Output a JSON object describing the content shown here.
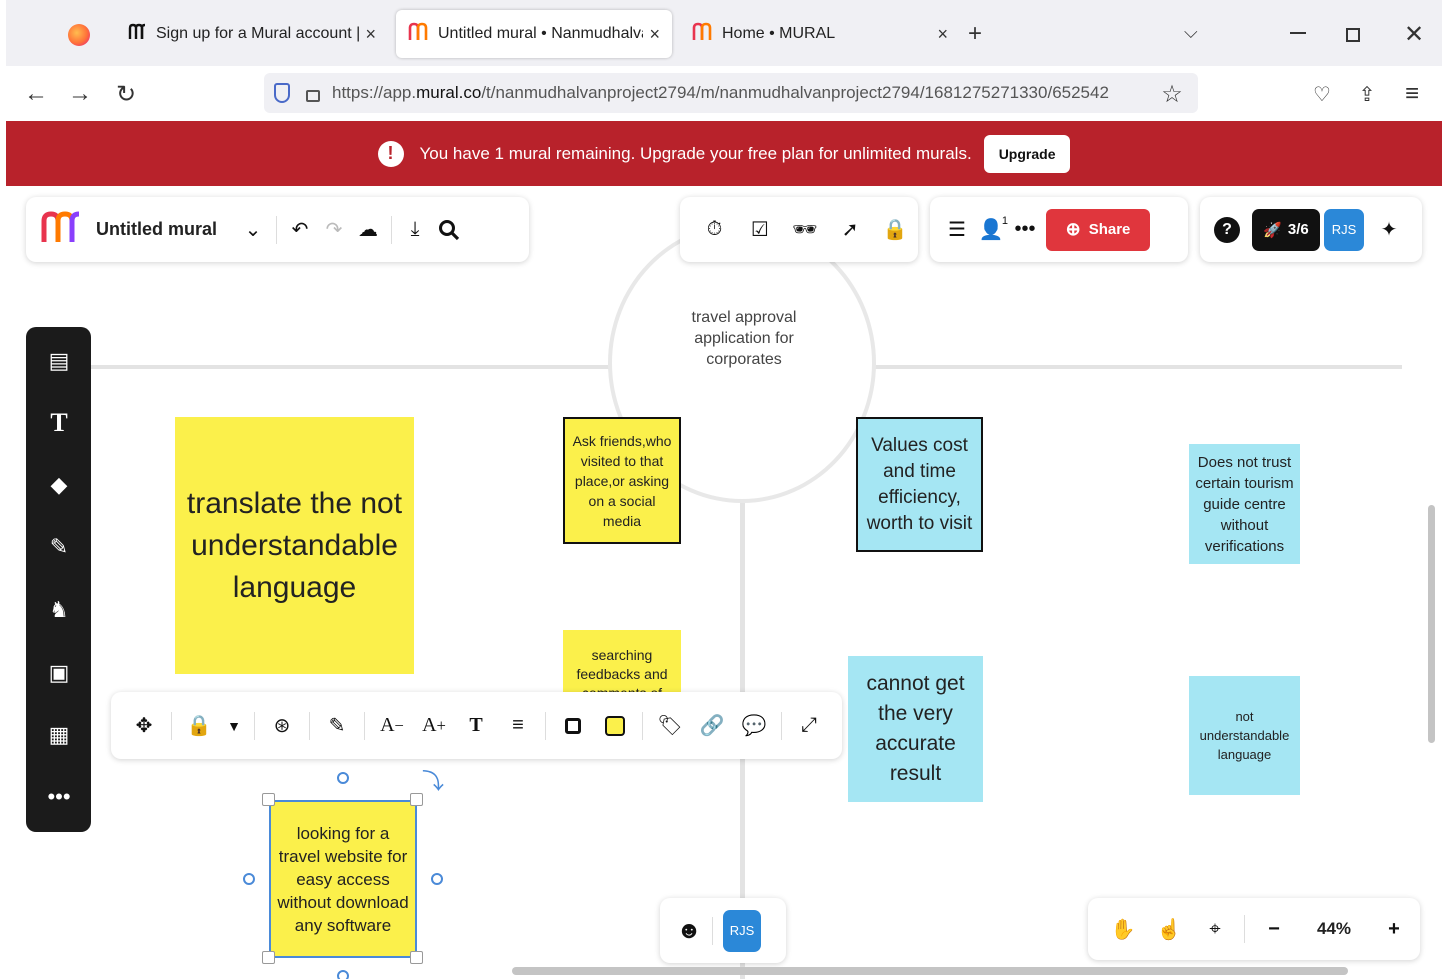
{
  "browser": {
    "tabs": [
      {
        "label": "Sign up for a Mural account | M",
        "close": "×"
      },
      {
        "label": "Untitled mural • Nanmudhalvan",
        "close": "×"
      },
      {
        "label": "Home • MURAL",
        "close": "×"
      }
    ],
    "new_tab": "+",
    "url_prefix": "https://app.",
    "url_domain": "mural.co",
    "url_rest": "/t/nanmudhalvanproject2794/m/nanmudhalvanproject2794/1681275271330/652542"
  },
  "banner": {
    "message": "You have 1 mural remaining. Upgrade your free plan for unlimited murals.",
    "upgrade_label": "Upgrade",
    "bg_color": "#b8222b"
  },
  "toolbar": {
    "mural_title": "Untitled mural",
    "share_label": "Share",
    "progress_label": "3/6",
    "avatar_initials": "RJS",
    "collab_count": "1"
  },
  "canvas": {
    "center_label": "travel approval application for corporates",
    "notes": {
      "translate": "translate the not understandable language",
      "ask_friends": "Ask friends,who visited to that place,or asking on a social media",
      "searching": "searching feedbacks and comments of",
      "values_cost": "Values cost and time efficiency, worth to visit",
      "does_not_trust": "Does not trust certain tourism guide centre without verifications",
      "cannot_get": "cannot get the very accurate result",
      "not_understandable": "not understandable language",
      "looking_for": "looking for a travel website for easy access without download any software"
    }
  },
  "bottom": {
    "avatar_initials": "RJS",
    "zoom": "44%"
  },
  "colors": {
    "sticky_yellow": "#fbf04b",
    "sticky_blue": "#a5e6f3",
    "share_red": "#e0363d",
    "avatar_blue": "#2b88d8"
  }
}
